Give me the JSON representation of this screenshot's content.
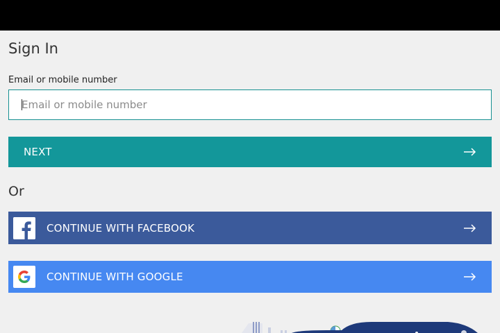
{
  "signin": {
    "title": "Sign In",
    "email_label": "Email or mobile number",
    "email_placeholder": "Email or mobile number",
    "email_value": "",
    "next_label": "NEXT",
    "or_text": "Or",
    "facebook_label": "CONTINUE WITH FACEBOOK",
    "google_label": "CONTINUE WITH GOOGLE"
  },
  "icons": {
    "next_arrow": "arrow-right-icon",
    "facebook": "facebook-icon",
    "google": "google-icon"
  },
  "colors": {
    "topbar": "#000000",
    "background": "#f0f0f0",
    "accent_teal": "#13979a",
    "facebook_blue": "#3b5a9b",
    "google_blue": "#4688f1",
    "illustration_navy": "#1e3a7a"
  }
}
